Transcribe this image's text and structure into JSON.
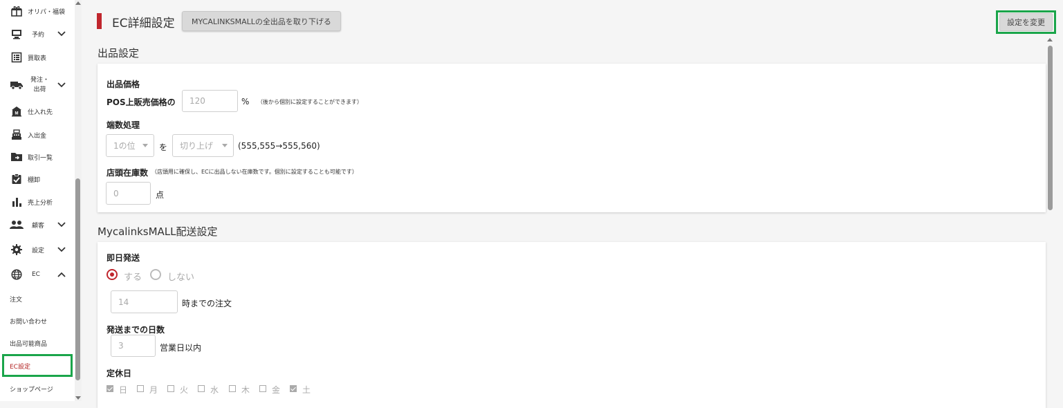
{
  "sidebar": {
    "items": [
      {
        "label": "オリパ・福袋",
        "icon": "gift-icon"
      },
      {
        "label": "予約",
        "icon": "monitor-icon"
      },
      {
        "label": "買取表",
        "icon": "list-icon"
      },
      {
        "label": "発注・\n出荷",
        "icon": "truck-icon"
      },
      {
        "label": "仕入れ先",
        "icon": "bank-icon"
      },
      {
        "label": "入出金",
        "icon": "register-icon"
      },
      {
        "label": "取引一覧",
        "icon": "folder-arrow-icon"
      },
      {
        "label": "棚卸",
        "icon": "clipboard-check-icon"
      },
      {
        "label": "売上分析",
        "icon": "bar-chart-icon"
      },
      {
        "label": "顧客",
        "icon": "people-icon"
      },
      {
        "label": "設定",
        "icon": "gear-icon"
      },
      {
        "label": "EC",
        "icon": "globe-icon"
      }
    ],
    "ec_sub": [
      "注文",
      "お問い合わせ",
      "出品可能商品",
      "EC設定",
      "ショップページ"
    ]
  },
  "header": {
    "title": "EC詳細設定",
    "withdraw_label": "MYCALINKSMALLの全出品を取り下げる",
    "change_label": "設定を変更"
  },
  "listing": {
    "section_title": "出品設定",
    "price_label": "出品価格",
    "pos_label": "POS上販売価格の",
    "percent_value": "120",
    "percent_unit": "%",
    "percent_note": "（後から個別に設定することができます）",
    "rounding_label": "端数処理",
    "digit_value": "1の位",
    "wo": "を",
    "round_value": "切り上げ",
    "round_example": "(555,555→555,560)",
    "stock_label": "店頭在庫数",
    "stock_note": "（店頭用に確保し、ECに出品しない在庫数です。個別に設定することも可能です）",
    "stock_value": "0",
    "stock_unit": "点"
  },
  "shipping": {
    "section_title": "MycalinksMALL配送設定",
    "same_day_label": "即日発送",
    "yes_label": "する",
    "no_label": "しない",
    "cutoff_value": "14",
    "cutoff_suffix": "時までの注文",
    "days_label": "発送までの日数",
    "days_value": "3",
    "days_suffix": "営業日以内",
    "holiday_label": "定休日",
    "weekdays": [
      "日",
      "月",
      "火",
      "水",
      "木",
      "金",
      "土"
    ]
  }
}
